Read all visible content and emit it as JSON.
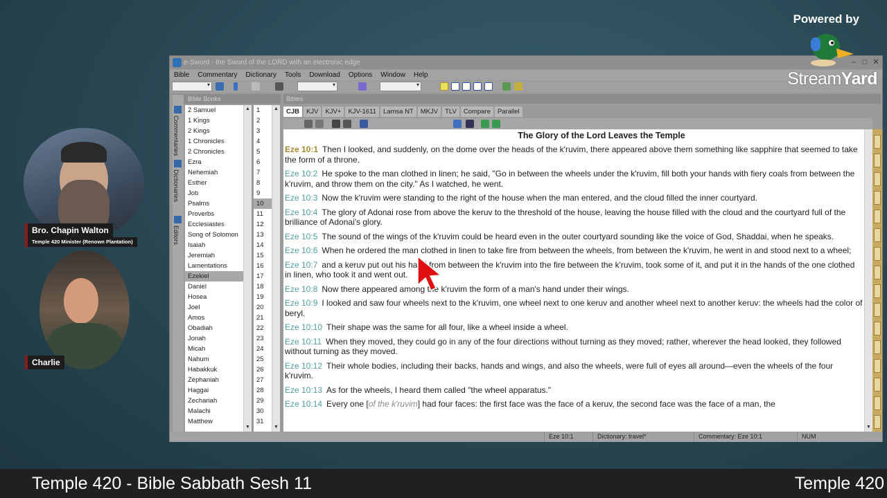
{
  "branding": {
    "powered_by": "Powered by",
    "logo_text_a": "Stream",
    "logo_text_b": "Yard"
  },
  "cameras": [
    {
      "name": "Bro. Chapin Walton",
      "subtitle": "Temple 420 Minister (Renown Plantation)"
    },
    {
      "name": "Charlie"
    }
  ],
  "window": {
    "title": "e-Sword - the Sword of the LORD with an electronic edge",
    "controls": [
      "–",
      "□",
      "✕"
    ],
    "menu": [
      "Bible",
      "Commentary",
      "Dictionary",
      "Tools",
      "Download",
      "Options",
      "Window",
      "Help"
    ],
    "side_tabs": [
      "Commentaries",
      "Dictionaries",
      "Editors"
    ],
    "books_header": "Bible Books",
    "bibles_header": "Bibles",
    "books": [
      "2 Samuel",
      "1 Kings",
      "2 Kings",
      "1 Chronicles",
      "2 Chronicles",
      "Ezra",
      "Nehemiah",
      "Esther",
      "Job",
      "Psalms",
      "Proverbs",
      "Ecclesiastes",
      "Song of Solomon",
      "Isaiah",
      "Jeremiah",
      "Lamentations",
      "Ezekiel",
      "Daniel",
      "Hosea",
      "Joel",
      "Amos",
      "Obadiah",
      "Jonah",
      "Micah",
      "Nahum",
      "Habakkuk",
      "Zephaniah",
      "Haggai",
      "Zechariah",
      "Malachi",
      "Matthew"
    ],
    "selected_book": "Ezekiel",
    "chapters": [
      "1",
      "2",
      "3",
      "4",
      "5",
      "6",
      "7",
      "8",
      "9",
      "10",
      "11",
      "12",
      "13",
      "14",
      "15",
      "16",
      "17",
      "18",
      "19",
      "20",
      "21",
      "22",
      "23",
      "24",
      "25",
      "26",
      "27",
      "28",
      "29",
      "30",
      "31"
    ],
    "selected_chapter": "10",
    "bible_tabs": [
      "CJB",
      "KJV",
      "KJV+",
      "KJV-1611",
      "Lamsa NT",
      "MKJV",
      "TLV",
      "Compare",
      "Parallel"
    ],
    "active_tab": "CJB",
    "heading": "The Glory of the Lord Leaves the Temple",
    "verses": [
      {
        "ref": "Eze 10:1",
        "text": "Then I looked, and suddenly, on the dome over the heads of the k'ruvim, there appeared above them something like sapphire that seemed to take the form of a throne."
      },
      {
        "ref": "Eze 10:2",
        "text": "He spoke to the man clothed in linen; he said, \"Go in between the wheels under the k'ruvim, fill both your hands with fiery coals from between the k'ruvim, and throw them on the city.\" As I watched, he went."
      },
      {
        "ref": "Eze 10:3",
        "text": "Now the k'ruvim were standing to the right of the house when the man entered, and the cloud filled the inner courtyard."
      },
      {
        "ref": "Eze 10:4",
        "text": "The glory of Adonai rose from above the keruv to the threshold of the house, leaving the house filled with the cloud and the courtyard full of the brilliance of Adonai's glory."
      },
      {
        "ref": "Eze 10:5",
        "text": "The sound of the wings of the k'ruvim could be heard even in the outer courtyard sounding like the voice of God, Shaddai, when he speaks."
      },
      {
        "ref": "Eze 10:6",
        "text": "When he ordered the man clothed in linen to take fire from between the wheels, from between the k'ruvim, he went in and stood next to a wheel;"
      },
      {
        "ref": "Eze 10:7",
        "text": "and a keruv put out his hand from between the k'ruvim into the fire between the k'ruvim, took some of it, and put it in the hands of the one clothed in linen, who took it and went out."
      },
      {
        "ref": "Eze 10:8",
        "text": "Now there appeared among the k'ruvim the form of a man's hand under their wings."
      },
      {
        "ref": "Eze 10:9",
        "text": "I looked and saw four wheels next to the k'ruvim, one wheel next to one keruv and another wheel next to another keruv: the wheels had the color of beryl."
      },
      {
        "ref": "Eze 10:10",
        "text": "Their shape was the same for all four, like a wheel inside a wheel."
      },
      {
        "ref": "Eze 10:11",
        "text": "When they moved, they could go in any of the four directions without turning as they moved; rather, wherever the head looked, they followed without turning as they moved."
      },
      {
        "ref": "Eze 10:12",
        "text": "Their whole bodies, including their backs, hands and wings, and also the wheels, were full of eyes all around—even the wheels of the four k'ruvim."
      },
      {
        "ref": "Eze 10:13",
        "text": "As for the wheels, I heard them called \"the wheel apparatus.\""
      },
      {
        "ref": "Eze 10:14",
        "text_a": "Every one [",
        "italic": "of the k'ruvim",
        "text_b": "] had four faces: the first face was the face of a keruv, the second face was the face of a man, the"
      }
    ],
    "status": {
      "verse": "Eze 10:1",
      "dictionary": "Dictionary: travel*",
      "commentary": "Commentary: Eze 10:1",
      "num": "NUM"
    }
  },
  "bottom": {
    "left": "Temple 420 - Bible Sabbath Sesh 11",
    "right": "Temple 420"
  },
  "colors": {
    "ref": "#4e9ea2",
    "ref_current": "#a8862c",
    "cursor": "#e01010"
  }
}
